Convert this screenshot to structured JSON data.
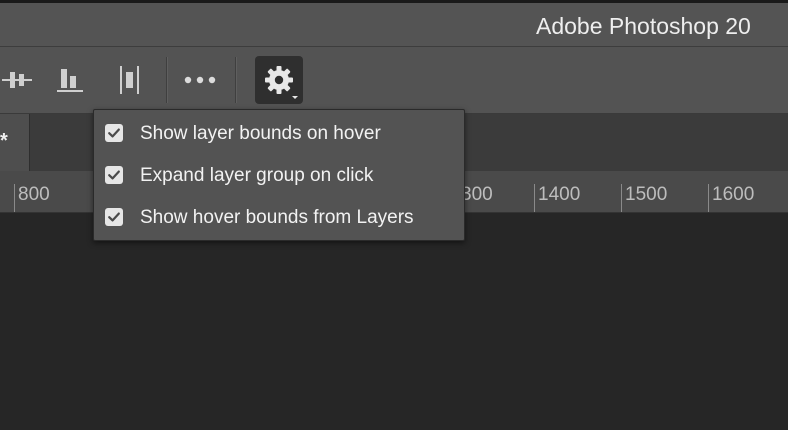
{
  "window": {
    "title": "Adobe Photoshop 20"
  },
  "options_bar": {
    "icons": [
      "align-vertical-centers-icon",
      "align-bottom-edges-icon",
      "distribute-horizontal-icon",
      "more-options-icon",
      "settings-gear-icon"
    ]
  },
  "document_tab": {
    "unsaved_marker": "*"
  },
  "ruler": {
    "labels": [
      "800",
      "300",
      "1400",
      "1500",
      "1600"
    ]
  },
  "settings_menu": {
    "items": [
      {
        "label": "Show layer bounds on hover",
        "checked": true
      },
      {
        "label": "Expand layer group on click",
        "checked": true
      },
      {
        "label": "Show hover bounds from Layers",
        "checked": true
      }
    ]
  },
  "colors": {
    "title_bar": "#545454",
    "options_bar": "#535353",
    "menu_bg": "#535353",
    "canvas": "#262626"
  }
}
